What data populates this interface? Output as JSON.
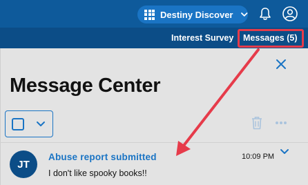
{
  "header": {
    "app_switcher_label": "Destiny Discover",
    "icons": {
      "apps": "grid-icon",
      "chevron": "chevron-down-icon",
      "notifications": "bell-icon",
      "account": "user-circle-icon"
    }
  },
  "subnav": {
    "tabs": [
      {
        "label": "Interest Survey"
      },
      {
        "label": "Messages (5)"
      }
    ]
  },
  "message_center": {
    "title": "Message Center",
    "toolbar": {
      "delete_icon": "trash-icon",
      "more_icon": "more-dots-icon"
    },
    "messages": [
      {
        "initials": "JT",
        "subject": "Abuse report submitted",
        "preview": "I don't like spooky books!!",
        "time": "10:09 PM"
      }
    ]
  },
  "annotation": {
    "highlight_color": "#e63b4a"
  },
  "colors": {
    "header": "#0e5a9b",
    "subnav": "#0c4d87",
    "accent": "#1a74c4",
    "panel": "#e3e3e3"
  }
}
